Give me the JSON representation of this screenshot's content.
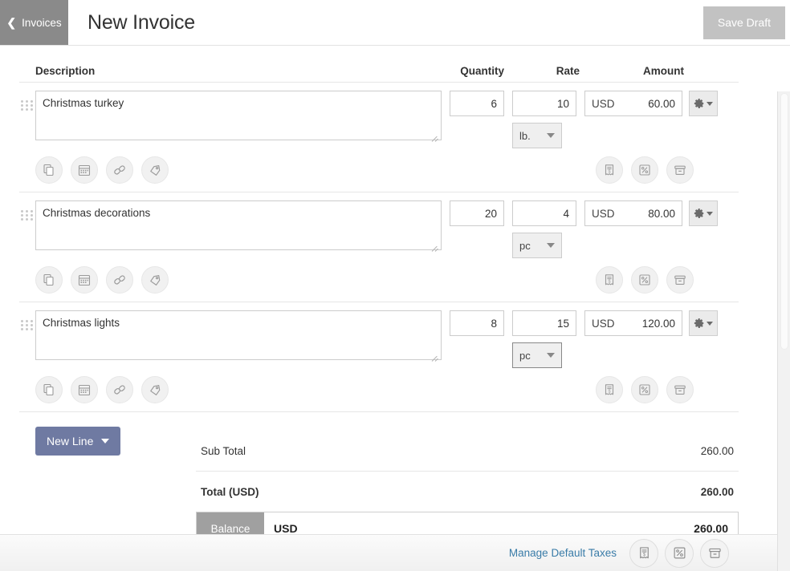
{
  "header": {
    "back_label": "Invoices",
    "back_icon": "chevron-left-icon",
    "title": "New Invoice",
    "save_label": "Save Draft"
  },
  "table": {
    "columns": {
      "description": "Description",
      "quantity": "Quantity",
      "rate": "Rate",
      "amount": "Amount"
    },
    "rows": [
      {
        "description": "Christmas turkey",
        "quantity": "6",
        "rate": "10",
        "unit": "lb.",
        "unit_focused": false,
        "currency": "USD",
        "amount": "60.00"
      },
      {
        "description": "Christmas decorations",
        "quantity": "20",
        "rate": "4",
        "unit": "pc",
        "unit_focused": false,
        "currency": "USD",
        "amount": "80.00"
      },
      {
        "description": "Christmas lights",
        "quantity": "8",
        "rate": "15",
        "unit": "pc",
        "unit_focused": true,
        "currency": "USD",
        "amount": "120.00"
      }
    ],
    "row_icons_left": [
      "copy-icon",
      "calendar-icon",
      "link-icon",
      "tag-icon"
    ],
    "row_icons_right": [
      "receipt-icon",
      "percent-icon",
      "archive-icon"
    ],
    "gear_icon": "gear-dropdown-icon",
    "drag_handle_icon": "drag-handle-icon"
  },
  "actions": {
    "new_line_label": "New Line",
    "new_line_caret": "caret-down-icon"
  },
  "totals": {
    "sub_total_label": "Sub Total",
    "sub_total_value": "260.00",
    "total_label": "Total (USD)",
    "total_value": "260.00",
    "balance_label": "Balance",
    "balance_currency": "USD",
    "balance_value": "260.00"
  },
  "footer": {
    "manage_taxes_label": "Manage Default Taxes",
    "icons": [
      "receipt-icon",
      "percent-icon",
      "archive-icon"
    ]
  },
  "colors": {
    "back_button_bg": "#8a8a8a",
    "save_button_bg": "#c2c2c2",
    "new_line_bg": "#6f7aa2",
    "balance_label_bg": "#a0a0a0",
    "link_blue": "#3a7ca8"
  }
}
